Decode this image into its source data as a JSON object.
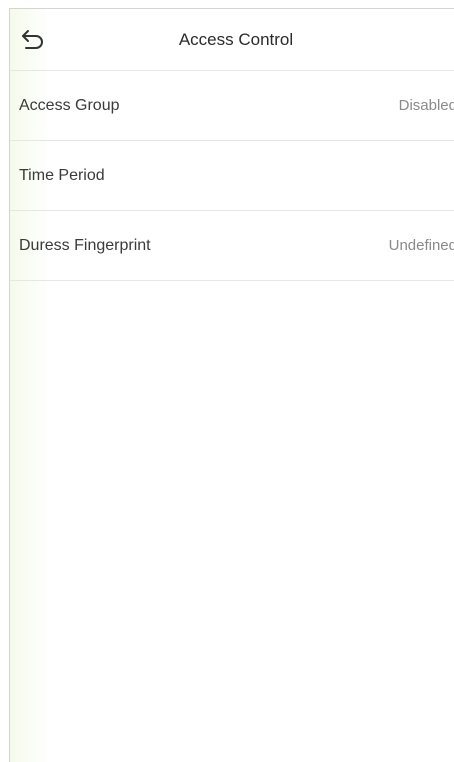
{
  "header": {
    "title": "Access Control",
    "back_icon": "back-arrow-icon"
  },
  "menu": {
    "items": [
      {
        "label": "Access Group",
        "value": "Disabled"
      },
      {
        "label": "Time Period",
        "value": ""
      },
      {
        "label": "Duress Fingerprint",
        "value": "Undefined"
      }
    ]
  },
  "colors": {
    "background": "#ffffff",
    "divider": "#e6e6e6",
    "label_text": "#3a3a3a",
    "value_text": "#8a8a8a"
  }
}
